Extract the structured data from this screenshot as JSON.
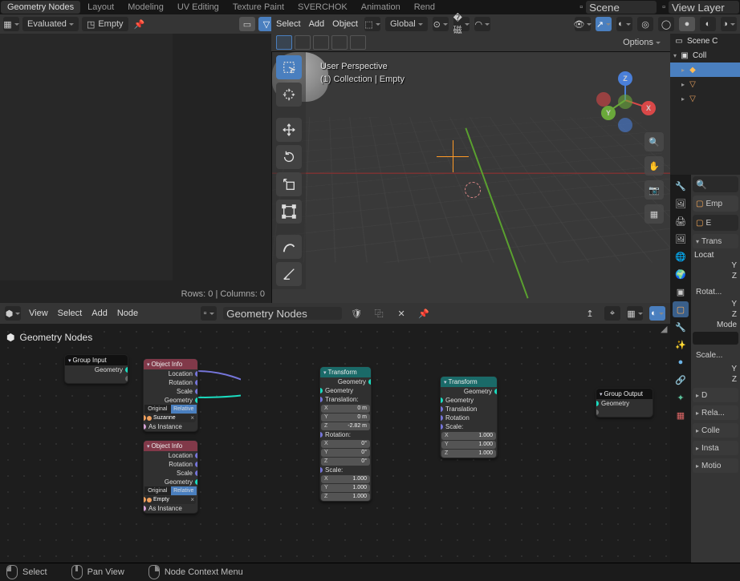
{
  "tabs": {
    "t0": "Geometry Nodes",
    "t1": "Layout",
    "t2": "Modeling",
    "t3": "UV Editing",
    "t4": "Texture Paint",
    "t5": "SVERCHOK",
    "t6": "Animation",
    "t7": "Rend"
  },
  "scene": {
    "label": "Scene",
    "view_layer": "View Layer"
  },
  "spreadsheet": {
    "mode": "Evaluated",
    "object": "Empty",
    "status": "Rows: 0   |   Columns: 0"
  },
  "view3d": {
    "menus": {
      "select": "Select",
      "add": "Add",
      "object": "Object"
    },
    "orient": "Global",
    "persp": "User Perspective",
    "context": "(1) Collection | Empty",
    "options": "Options",
    "axis": {
      "x": "X",
      "y": "Y",
      "z": "Z"
    }
  },
  "outliner": {
    "scene": "Scene C",
    "coll": "Coll",
    "items": [
      "",
      "",
      ""
    ]
  },
  "props": {
    "object": "Emp",
    "name": "E",
    "panel_transform": "Trans",
    "loc": "Locat",
    "y": "Y",
    "z": "Z",
    "panel_rot": "Rotat...",
    "mode": "Mode",
    "panel_scale": "Scale...",
    "panel_delta": "D",
    "panel_rel": "Rela...",
    "panel_coll": "Colle",
    "panel_inst": "Insta",
    "panel_motion": "Motio"
  },
  "node_editor": {
    "menus": {
      "view": "View",
      "select": "Select",
      "add": "Add",
      "node": "Node"
    },
    "tree_name": "Geometry Nodes",
    "title": "Geometry Nodes"
  },
  "nodes": {
    "group_input": {
      "title": "Group Input",
      "o0": "Geometry"
    },
    "obj1": {
      "title": "Object Info",
      "o0": "Location",
      "o1": "Rotation",
      "o2": "Scale",
      "o3": "Geometry",
      "tog_a": "Original",
      "tog_b": "Relative",
      "obj": "Suzanne",
      "asinst": "As Instance"
    },
    "obj2": {
      "title": "Object Info",
      "o0": "Location",
      "o1": "Rotation",
      "o2": "Scale",
      "o3": "Geometry",
      "tog_a": "Original",
      "tog_b": "Relative",
      "obj": "Empty",
      "asinst": "As Instance"
    },
    "xf1": {
      "title": "Transform",
      "out": "Geometry",
      "in": "Geometry",
      "lab_t": "Translation:",
      "lab_r": "Rotation:",
      "lab_s": "Scale:",
      "tx": "X",
      "tx_v": "0 m",
      "ty": "Y",
      "ty_v": "0 m",
      "tz": "Z",
      "tz_v": "-2.82 m",
      "rx": "X",
      "rx_v": "0°",
      "ry": "Y",
      "ry_v": "0°",
      "rz": "Z",
      "rz_v": "0°",
      "sx": "X",
      "sx_v": "1.000",
      "sy": "Y",
      "sy_v": "1.000",
      "sz": "Z",
      "sz_v": "1.000"
    },
    "xf2": {
      "title": "Transform",
      "out": "Geometry",
      "in": "Geometry",
      "lab_t": "Translation",
      "lab_r": "Rotation",
      "lab_s": "Scale:",
      "sx": "X",
      "sx_v": "1.000",
      "sy": "Y",
      "sy_v": "1.000",
      "sz": "Z",
      "sz_v": "1.000"
    },
    "group_output": {
      "title": "Group Output",
      "in": "Geometry"
    }
  },
  "status": {
    "a": "Select",
    "b": "Pan View",
    "c": "Node Context Menu"
  }
}
